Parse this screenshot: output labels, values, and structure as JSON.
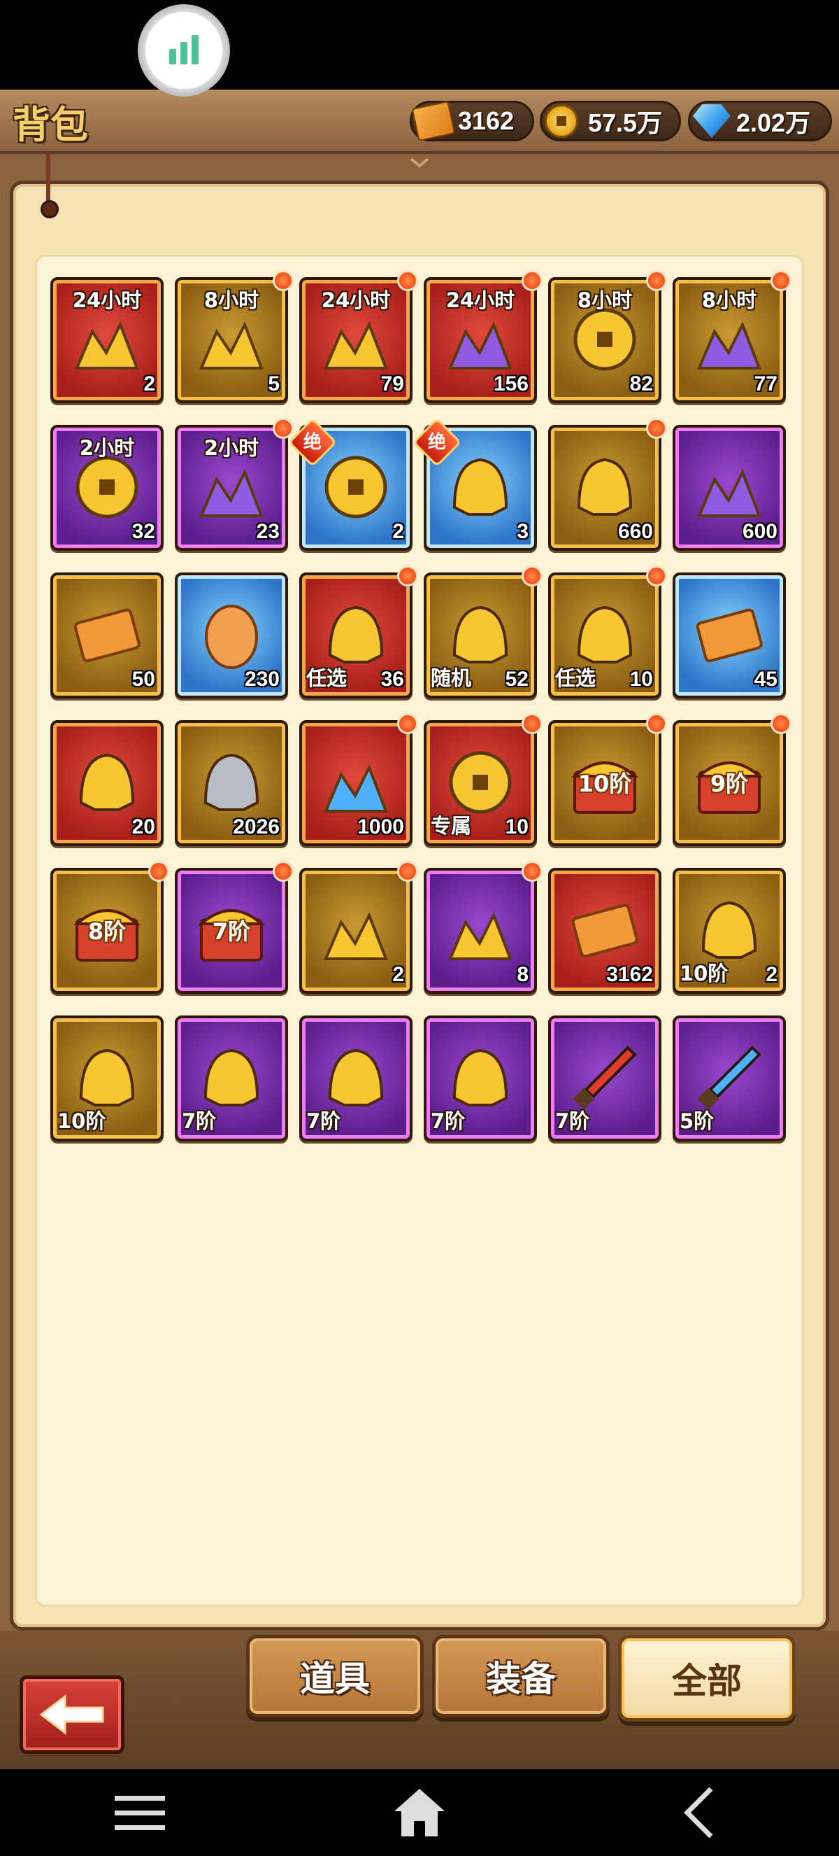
{
  "header": {
    "title": "背包",
    "currencies": [
      {
        "icon": "ticket-icon",
        "value": "3162"
      },
      {
        "icon": "gold-coin-icon",
        "value": "57.5万"
      },
      {
        "icon": "diamond-icon",
        "value": "2.02万"
      }
    ]
  },
  "items": [
    {
      "frame": "red",
      "top": "24小时",
      "count": "2",
      "dot": false,
      "icon": "gold-ingot-pile-icon"
    },
    {
      "frame": "gold",
      "top": "8小时",
      "count": "5",
      "dot": true,
      "icon": "gold-ingot-pile-icon"
    },
    {
      "frame": "red",
      "top": "24小时",
      "count": "79",
      "dot": true,
      "icon": "treasure-gold-icon"
    },
    {
      "frame": "red",
      "top": "24小时",
      "count": "156",
      "dot": true,
      "icon": "purple-crystal-pile-icon"
    },
    {
      "frame": "gold",
      "top": "8小时",
      "count": "82",
      "dot": true,
      "icon": "coin-pile-icon"
    },
    {
      "frame": "gold",
      "top": "8小时",
      "count": "77",
      "dot": true,
      "icon": "purple-crystal-pile-icon"
    },
    {
      "frame": "purple",
      "top": "2小时",
      "count": "32",
      "dot": false,
      "icon": "coin-pile-icon"
    },
    {
      "frame": "purple",
      "top": "2小时",
      "count": "23",
      "dot": true,
      "icon": "purple-crystal-icon"
    },
    {
      "frame": "blue",
      "badge": "绝",
      "count": "2",
      "dot": false,
      "icon": "mystery-token-icon"
    },
    {
      "frame": "blue",
      "badge": "绝",
      "count": "3",
      "dot": false,
      "icon": "mystery-helmet-icon"
    },
    {
      "frame": "gold",
      "count": "660",
      "dot": true,
      "icon": "mystery-helmet-icon"
    },
    {
      "frame": "purple",
      "count": "600",
      "dot": false,
      "icon": "card-pack-icon"
    },
    {
      "frame": "gold",
      "count": "50",
      "dot": false,
      "icon": "ticket-card-icon"
    },
    {
      "frame": "blue",
      "count": "230",
      "dot": false,
      "icon": "egg-icon"
    },
    {
      "frame": "red",
      "bottom": "任选",
      "count": "36",
      "dot": true,
      "icon": "select-helmet-icon"
    },
    {
      "frame": "gold",
      "bottom": "随机",
      "count": "52",
      "dot": true,
      "icon": "random-helmet-icon"
    },
    {
      "frame": "gold",
      "bottom": "任选",
      "count": "10",
      "dot": true,
      "icon": "golden-helmet-icon"
    },
    {
      "frame": "blue",
      "count": "45",
      "dot": false,
      "icon": "scroll-bundle-icon"
    },
    {
      "frame": "red",
      "count": "20",
      "dot": false,
      "icon": "gold-badge-icon"
    },
    {
      "frame": "gold",
      "count": "2026",
      "dot": false,
      "icon": "silver-badge-icon"
    },
    {
      "frame": "red",
      "count": "1000",
      "dot": true,
      "icon": "blue-crystal-icon"
    },
    {
      "frame": "red",
      "bottom": "专属",
      "count": "10",
      "dot": true,
      "icon": "exclusive-token-icon"
    },
    {
      "frame": "gold",
      "center": "10阶",
      "dot": true,
      "icon": "treasure-chest-icon"
    },
    {
      "frame": "gold",
      "center": "9阶",
      "dot": true,
      "icon": "treasure-chest-icon"
    },
    {
      "frame": "gold",
      "center": "8阶",
      "dot": true,
      "icon": "treasure-chest-icon"
    },
    {
      "frame": "purple",
      "center": "7阶",
      "dot": true,
      "icon": "purple-chest-icon"
    },
    {
      "frame": "gold",
      "count": "2",
      "dot": true,
      "icon": "gold-shards-icon"
    },
    {
      "frame": "purple",
      "count": "8",
      "dot": true,
      "icon": "gold-shards-icon"
    },
    {
      "frame": "red",
      "count": "3162",
      "dot": false,
      "icon": "voucher-icon"
    },
    {
      "frame": "gold",
      "bottom": "10阶",
      "count": "2",
      "dot": false,
      "icon": "armor-icon"
    },
    {
      "frame": "gold",
      "bottom": "10阶",
      "dot": false,
      "icon": "dragon-helmet-icon"
    },
    {
      "frame": "purple",
      "bottom": "7阶",
      "dot": false,
      "icon": "boots-icon"
    },
    {
      "frame": "purple",
      "bottom": "7阶",
      "dot": false,
      "icon": "skull-armor-icon"
    },
    {
      "frame": "purple",
      "bottom": "7阶",
      "dot": false,
      "icon": "horned-helmet-icon"
    },
    {
      "frame": "purple",
      "bottom": "7阶",
      "dot": false,
      "icon": "red-sword-icon"
    },
    {
      "frame": "purple",
      "bottom": "5阶",
      "dot": false,
      "icon": "blue-sword-icon"
    }
  ],
  "tabs": [
    {
      "label": "道具",
      "active": false
    },
    {
      "label": "装备",
      "active": false
    },
    {
      "label": "全部",
      "active": true
    }
  ],
  "colors": {
    "frame_red": "#c2261e",
    "frame_gold": "#a8731a",
    "frame_purple": "#7a2fb0",
    "frame_blue": "#3a8ae0",
    "badge": "#f0501a"
  }
}
